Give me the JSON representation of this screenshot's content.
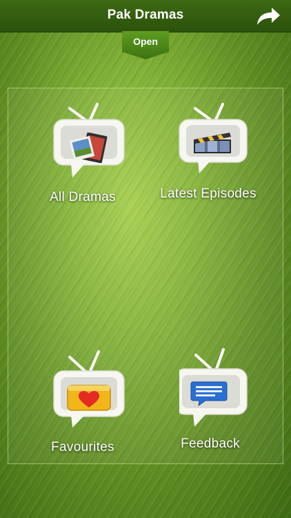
{
  "header": {
    "title": "Pak Dramas",
    "open_label": "Open"
  },
  "menu": {
    "items": [
      {
        "label": "All Dramas",
        "icon": "film-photos-icon"
      },
      {
        "label": "Latest Episodes",
        "icon": "clapperboard-icon"
      },
      {
        "label": "Favourites",
        "icon": "heart-icon"
      },
      {
        "label": "Feedback",
        "icon": "chat-bubble-icon"
      }
    ]
  },
  "colors": {
    "navbar": "#2f5a0e",
    "background": "#7aa833",
    "tab": "#4f8a1a",
    "text": "#ffffff"
  }
}
